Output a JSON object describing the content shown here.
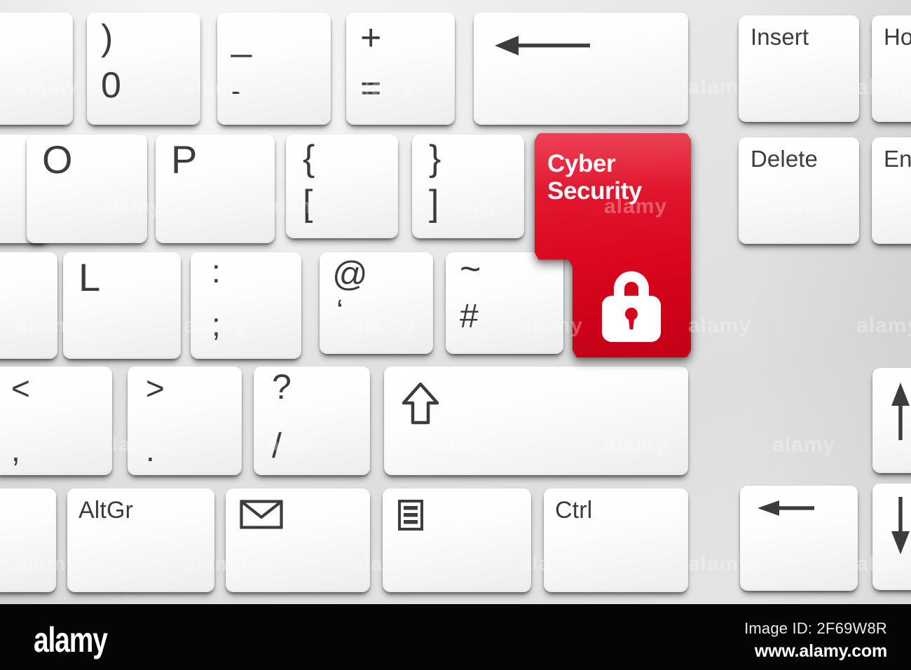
{
  "image": {
    "footer_logo": "alamy",
    "image_id_label": "Image ID: 2F69W8R",
    "url": "www.alamy.com",
    "watermark_text": "alamy"
  },
  "colors": {
    "key_face": "#FBFBFB",
    "key_text": "#3C3C3E",
    "plate_background": "#E2E2E2",
    "accent_red": "#DC0A21",
    "footer_background": "#050505"
  },
  "highlight_key": {
    "name": "enter-key",
    "line1": "Cyber",
    "line2": "Security",
    "icon": "padlock-icon",
    "color": "#DC0A21",
    "text_color": "#FFFFFF"
  },
  "keys": {
    "row_number": [
      {
        "id": "key-9-partial",
        "top": "",
        "bottom": "",
        "icon": ""
      },
      {
        "id": "key-0",
        "top": ")",
        "bottom": "0",
        "icon": ""
      },
      {
        "id": "key-minus",
        "top": "_",
        "bottom": "-",
        "icon": ""
      },
      {
        "id": "key-equals",
        "top": "+",
        "bottom": "=",
        "icon": ""
      },
      {
        "id": "key-backspace",
        "top": "",
        "bottom": "",
        "icon": "arrow-left-icon"
      }
    ],
    "row_top": [
      {
        "id": "key-i-partial",
        "top": "",
        "bottom": "",
        "icon": ""
      },
      {
        "id": "key-o",
        "top": "O",
        "bottom": "",
        "icon": ""
      },
      {
        "id": "key-p",
        "top": "P",
        "bottom": "",
        "icon": ""
      },
      {
        "id": "key-bracket-left",
        "top": "{",
        "bottom": "[",
        "icon": ""
      },
      {
        "id": "key-bracket-right",
        "top": "}",
        "bottom": "]",
        "icon": ""
      }
    ],
    "row_home": [
      {
        "id": "key-k-partial",
        "top": "",
        "bottom": "",
        "icon": ""
      },
      {
        "id": "key-l",
        "top": "L",
        "bottom": "",
        "icon": ""
      },
      {
        "id": "key-semicolon",
        "top": ":",
        "bottom": ";",
        "icon": ""
      },
      {
        "id": "key-apostrophe",
        "top": "@",
        "bottom": "‘",
        "icon": ""
      },
      {
        "id": "key-hash",
        "top": "~",
        "bottom": "#",
        "icon": ""
      }
    ],
    "row_shift": [
      {
        "id": "key-comma",
        "top": "<",
        "bottom": ",",
        "icon": ""
      },
      {
        "id": "key-period",
        "top": ">",
        "bottom": ".",
        "icon": ""
      },
      {
        "id": "key-slash",
        "top": "?",
        "bottom": "/",
        "icon": ""
      },
      {
        "id": "key-shift-right",
        "top": "",
        "bottom": "",
        "icon": "shift-arrow-icon"
      }
    ],
    "row_bottom": [
      {
        "id": "key-space-partial",
        "top": "",
        "bottom": "",
        "icon": ""
      },
      {
        "id": "key-altgr",
        "top": "AltGr",
        "bottom": "",
        "icon": ""
      },
      {
        "id": "key-mail",
        "top": "",
        "bottom": "",
        "icon": "envelope-icon"
      },
      {
        "id": "key-menu",
        "top": "",
        "bottom": "",
        "icon": "menu-icon"
      },
      {
        "id": "key-ctrl-right",
        "top": "Ctrl",
        "bottom": "",
        "icon": ""
      }
    ],
    "nav_cluster": [
      {
        "id": "key-insert",
        "top": "Insert",
        "bottom": "",
        "icon": ""
      },
      {
        "id": "key-home",
        "top": "Home",
        "bottom": "",
        "icon": ""
      },
      {
        "id": "key-delete",
        "top": "Delete",
        "bottom": "",
        "icon": ""
      },
      {
        "id": "key-end",
        "top": "End",
        "bottom": "",
        "icon": ""
      }
    ],
    "arrow_cluster": [
      {
        "id": "key-arrow-up",
        "top": "",
        "bottom": "",
        "icon": "arrow-up-icon"
      },
      {
        "id": "key-arrow-down",
        "top": "",
        "bottom": "",
        "icon": "arrow-down-icon"
      },
      {
        "id": "key-arrow-left",
        "top": "",
        "bottom": "",
        "icon": "arrow-left-icon"
      }
    ]
  }
}
